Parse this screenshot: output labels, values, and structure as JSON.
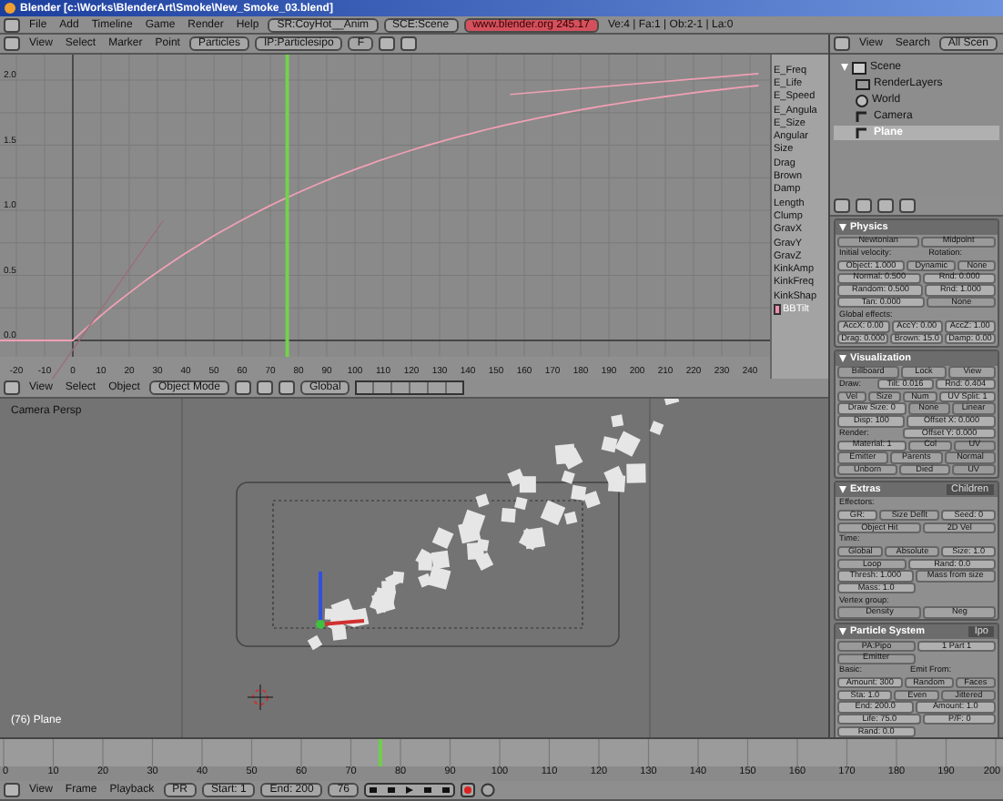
{
  "window": {
    "title": "Blender [c:\\Works\\BlenderArt\\Smoke\\New_Smoke_03.blend]"
  },
  "menu": {
    "items": [
      "File",
      "Add",
      "Timeline",
      "Game",
      "Render",
      "Help"
    ],
    "screen": "SR:CoyHot__Anim",
    "scene": "SCE:Scene",
    "info": "www.blender.org 245.17",
    "stats": "Ve:4 | Fa:1 | Ob:2-1 | La:0"
  },
  "ipo_header": {
    "menus": [
      "View",
      "Select",
      "Marker",
      "Point"
    ],
    "type": "Particles",
    "block": "IP:Particlesipo",
    "block_button": "F"
  },
  "ipo": {
    "x_ticks": [
      "-20",
      "-10",
      "0",
      "10",
      "20",
      "30",
      "40",
      "50",
      "60",
      "70",
      "80",
      "90",
      "100",
      "110",
      "120",
      "130",
      "140",
      "150",
      "160",
      "170",
      "180",
      "190",
      "200",
      "210",
      "220",
      "230",
      "240"
    ],
    "y_ticks": [
      "2.0",
      "1.5",
      "1.0",
      "0.5",
      "0.0"
    ],
    "channels": [
      {
        "name": "E_Freq",
        "selected": false
      },
      {
        "name": "E_Life",
        "selected": false
      },
      {
        "name": "E_Speed",
        "selected": false
      },
      {
        "name": "E_Angula",
        "selected": false
      },
      {
        "name": "E_Size",
        "selected": false
      },
      {
        "name": "Angular",
        "selected": false
      },
      {
        "name": "Size",
        "selected": false
      },
      {
        "name": "Drag",
        "selected": false
      },
      {
        "name": "Brown",
        "selected": false
      },
      {
        "name": "Damp",
        "selected": false
      },
      {
        "name": "Length",
        "selected": false
      },
      {
        "name": "Clump",
        "selected": false
      },
      {
        "name": "GravX",
        "selected": false
      },
      {
        "name": "GravY",
        "selected": false
      },
      {
        "name": "GravZ",
        "selected": false
      },
      {
        "name": "KinkAmp",
        "selected": false
      },
      {
        "name": "KinkFreq",
        "selected": false
      },
      {
        "name": "KinkShap",
        "selected": false
      },
      {
        "name": "BBTilt",
        "selected": true
      }
    ]
  },
  "outliner_header": {
    "menus": [
      "View",
      "Search"
    ],
    "filter": "All Scen"
  },
  "outliner": {
    "items": [
      {
        "name": "Scene",
        "kind": "scene",
        "selected": false,
        "children": [
          {
            "name": "RenderLayers",
            "kind": "layers",
            "selected": false
          },
          {
            "name": "World",
            "kind": "world",
            "selected": false
          },
          {
            "name": "Camera",
            "kind": "object",
            "selected": false
          },
          {
            "name": "Plane",
            "kind": "object",
            "selected": true
          }
        ]
      }
    ]
  },
  "view3d_header": {
    "menus": [
      "View",
      "Select",
      "Object"
    ],
    "mode": "Object Mode",
    "orientation": "Global"
  },
  "view3d": {
    "view_name": "Camera Persp",
    "object_label": "(76) Plane"
  },
  "panels": [
    {
      "title": "Physics",
      "rows": [
        [
          {
            "t": "Newtonian",
            "kind": "menu"
          },
          {
            "t": "Midpoint",
            "kind": "menu"
          }
        ],
        [
          {
            "t": "Initial velocity:",
            "kind": "label"
          },
          {
            "t": "Rotation:",
            "kind": "label"
          }
        ],
        [
          {
            "t": "Object: 1.000",
            "kind": "num"
          },
          {
            "t": "Dynamic",
            "kind": "button"
          },
          {
            "t": "None",
            "kind": "button"
          }
        ],
        [
          {
            "t": "Normal: 0.500",
            "kind": "num"
          },
          {
            "t": "Rnd: 0.000",
            "kind": "num"
          }
        ],
        [
          {
            "t": "Random: 0.500",
            "kind": "num"
          },
          {
            "t": "Rnd: 1.000",
            "kind": "num"
          }
        ],
        [
          {
            "t": "Tan: 0.000",
            "kind": "num"
          },
          {
            "t": "None",
            "kind": "menu"
          }
        ],
        [
          {
            "t": "Global effects:",
            "kind": "label"
          }
        ],
        [
          {
            "t": "AccX: 0.00",
            "kind": "num"
          },
          {
            "t": "AccY: 0.00",
            "kind": "num"
          },
          {
            "t": "AccZ: 1.00",
            "kind": "num"
          }
        ],
        [
          {
            "t": "Drag: 0.000",
            "kind": "num"
          },
          {
            "t": "Brown: 15.0",
            "kind": "num"
          },
          {
            "t": "Damp: 0.00",
            "kind": "num"
          }
        ]
      ]
    },
    {
      "title": "Visualization",
      "rows": [
        [
          {
            "t": "Billboard",
            "kind": "menu"
          },
          {
            "t": "Lock",
            "kind": "button"
          },
          {
            "t": "View",
            "kind": "button"
          }
        ],
        [
          {
            "t": "Draw:",
            "kind": "label"
          },
          {
            "t": "Tilt: 0.016",
            "kind": "num"
          },
          {
            "t": "Rnd: 0.404",
            "kind": "num"
          }
        ],
        [
          {
            "t": "Vel",
            "kind": "button"
          },
          {
            "t": "Size",
            "kind": "button"
          },
          {
            "t": "Num",
            "kind": "button"
          },
          {
            "t": "UV Split: 1",
            "kind": "num"
          }
        ],
        [
          {
            "t": "Draw Size: 0",
            "kind": "num"
          },
          {
            "t": "None",
            "kind": "menu"
          },
          {
            "t": "Linear",
            "kind": "menu"
          }
        ],
        [
          {
            "t": "Disp: 100",
            "kind": "num"
          },
          {
            "t": "Offset X: 0.000",
            "kind": "num"
          }
        ],
        [
          {
            "t": "Render:",
            "kind": "label"
          },
          {
            "t": "Offset Y: 0.000",
            "kind": "num"
          }
        ],
        [
          {
            "t": "Material: 1",
            "kind": "num"
          },
          {
            "t": "Col",
            "kind": "button"
          },
          {
            "t": "UV",
            "kind": "menu"
          }
        ],
        [
          {
            "t": "Emitter",
            "kind": "button"
          },
          {
            "t": "Parents",
            "kind": "button"
          },
          {
            "t": "Normal",
            "kind": "menu"
          }
        ],
        [
          {
            "t": "Unborn",
            "kind": "button"
          },
          {
            "t": "Died",
            "kind": "button"
          },
          {
            "t": "UV",
            "kind": "menu"
          }
        ]
      ]
    },
    {
      "title": "Extras",
      "tab": "Children",
      "rows": [
        [
          {
            "t": "Effectors:",
            "kind": "label"
          }
        ],
        [
          {
            "t": "GR:",
            "kind": "num"
          },
          {
            "t": "Size Deflt",
            "kind": "button"
          },
          {
            "t": "Seed: 0",
            "kind": "num"
          }
        ],
        [
          {
            "t": "Object Hit",
            "kind": "button"
          },
          {
            "t": "2D Vel",
            "kind": "button"
          }
        ],
        [
          {
            "t": "Time:",
            "kind": "label"
          }
        ],
        [
          {
            "t": "Global",
            "kind": "button"
          },
          {
            "t": "Absolute",
            "kind": "button"
          },
          {
            "t": "Size: 1.0",
            "kind": "num"
          }
        ],
        [
          {
            "t": "Loop",
            "kind": "button"
          },
          {
            "t": "Rand: 0.0",
            "kind": "num"
          }
        ],
        [
          {
            "t": "Thresh: 1.000",
            "kind": "num"
          },
          {
            "t": "Mass from size",
            "kind": "button"
          }
        ],
        [
          {
            "t": "Mass: 1.0",
            "kind": "num"
          }
        ],
        [
          {
            "t": "Vertex group:",
            "kind": "label"
          }
        ],
        [
          {
            "t": "Density",
            "kind": "menu"
          },
          {
            "t": "Neg",
            "kind": "button"
          }
        ]
      ]
    },
    {
      "title": "Particle System",
      "tab": "Ipo",
      "rows": [
        [
          {
            "t": "PA:Pipo",
            "kind": "menu"
          },
          {
            "t": "1 Part 1",
            "kind": "num"
          }
        ],
        [
          {
            "t": "Emitter",
            "kind": "menu"
          }
        ],
        [
          {
            "t": "Basic:",
            "kind": "label"
          },
          {
            "t": "Emit From:",
            "kind": "label"
          }
        ],
        [
          {
            "t": "Amount: 300",
            "kind": "num"
          },
          {
            "t": "Random",
            "kind": "button"
          },
          {
            "t": "Faces",
            "kind": "menu"
          }
        ],
        [
          {
            "t": "Sta: 1.0",
            "kind": "num"
          },
          {
            "t": "Even",
            "kind": "button"
          },
          {
            "t": "Jittered",
            "kind": "menu"
          }
        ],
        [
          {
            "t": "End: 200.0",
            "kind": "num"
          },
          {
            "t": "Amount: 1.0",
            "kind": "num"
          }
        ],
        [
          {
            "t": "Life: 75.0",
            "kind": "num"
          },
          {
            "t": "P/F: 0",
            "kind": "num"
          }
        ],
        [
          {
            "t": "Rand: 0.0",
            "kind": "num"
          }
        ]
      ]
    }
  ],
  "timeline": {
    "level": 0.38,
    "ticks": [
      "0",
      "10",
      "20",
      "30",
      "40",
      "50",
      "60",
      "70",
      "80",
      "90",
      "100",
      "110",
      "120",
      "130",
      "140",
      "150",
      "160",
      "170",
      "180",
      "190",
      "200"
    ]
  },
  "timeline_header": {
    "menus": [
      "View",
      "Frame",
      "Playback"
    ],
    "preview": "PR",
    "start": "Start: 1",
    "end": "End: 200",
    "frame": "76"
  }
}
